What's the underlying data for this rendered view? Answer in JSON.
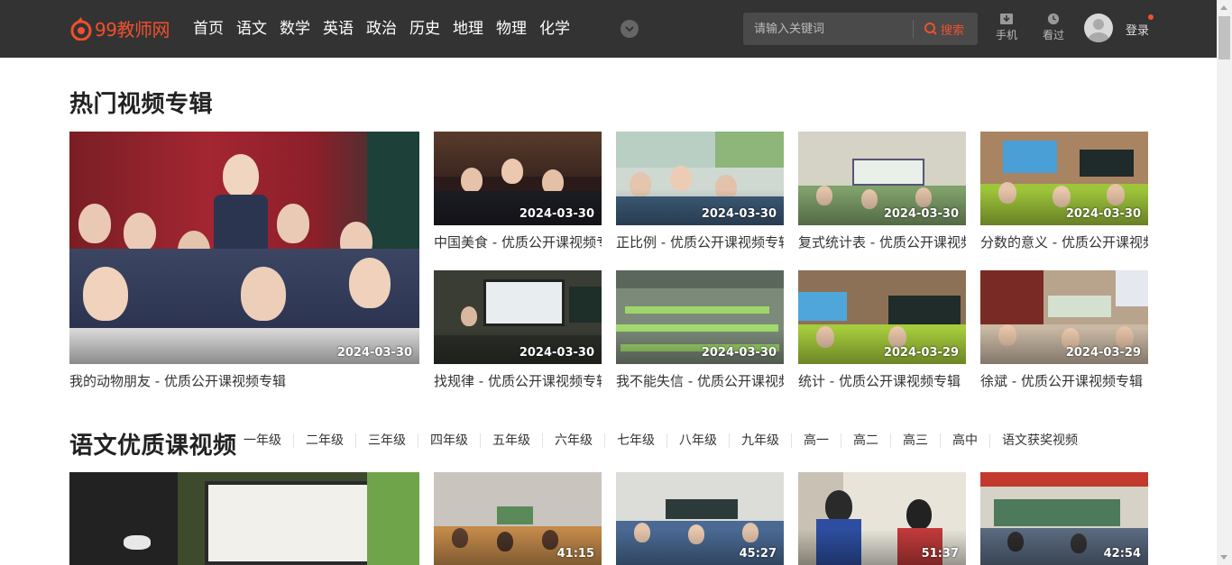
{
  "header": {
    "logo_text": "99教师网",
    "nav": [
      "首页",
      "语文",
      "数学",
      "英语",
      "政治",
      "历史",
      "地理",
      "物理",
      "化学"
    ],
    "search_placeholder": "请输入关键词",
    "search_button": "搜索",
    "tools": [
      {
        "label": "手机",
        "icon": "phone-download-icon"
      },
      {
        "label": "看过",
        "icon": "history-clock-icon"
      }
    ],
    "login": "登录",
    "accent": "#f0502d",
    "bg": "#333333"
  },
  "hot": {
    "title": "热门视频专辑",
    "items": [
      {
        "caption": "我的动物朋友 - 优质公开课视频专辑",
        "date": "2024-03-30"
      },
      {
        "caption": "中国美食 - 优质公开课视频专辑",
        "date": "2024-03-30"
      },
      {
        "caption": "正比例 - 优质公开课视频专辑",
        "date": "2024-03-30"
      },
      {
        "caption": "复式统计表 - 优质公开课视频专辑",
        "date": "2024-03-30"
      },
      {
        "caption": "分数的意义 - 优质公开课视频专辑",
        "date": "2024-03-30"
      },
      {
        "caption": "找规律 - 优质公开课视频专辑",
        "date": "2024-03-30"
      },
      {
        "caption": "我不能失信 - 优质公开课视频专辑",
        "date": "2024-03-30"
      },
      {
        "caption": "统计 - 优质公开课视频专辑",
        "date": "2024-03-29"
      },
      {
        "caption": "徐斌 - 优质公开课视频专辑",
        "date": "2024-03-29"
      }
    ]
  },
  "chinese": {
    "title": "语文优质课视频",
    "grades": [
      "一年级",
      "二年级",
      "三年级",
      "四年级",
      "五年级",
      "六年级",
      "七年级",
      "八年级",
      "九年级",
      "高一",
      "高二",
      "高三",
      "高中",
      "语文获奖视频"
    ],
    "items": [
      {
        "duration": ""
      },
      {
        "duration": "41:15"
      },
      {
        "duration": "45:27"
      },
      {
        "duration": "51:37"
      },
      {
        "duration": "42:54"
      }
    ]
  }
}
